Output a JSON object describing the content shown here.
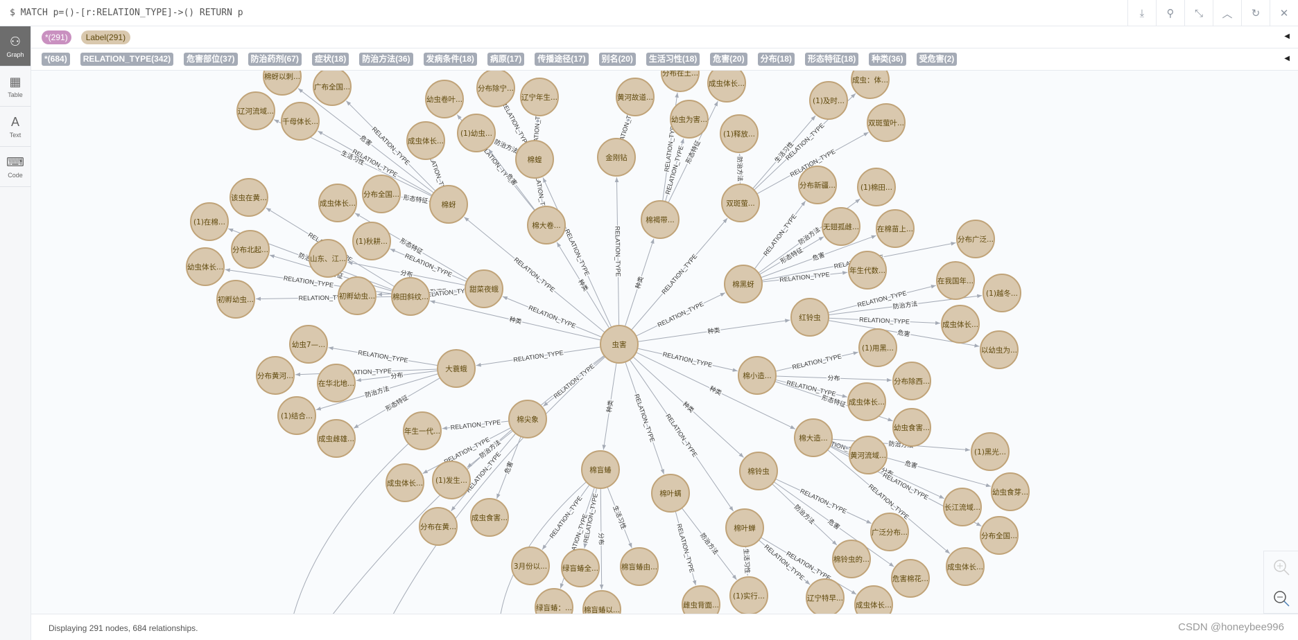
{
  "query": {
    "text": "$ MATCH p=()-[r:RELATION_TYPE]->() RETURN p",
    "buttons": [
      {
        "name": "download-icon",
        "glyph": "⤓"
      },
      {
        "name": "pin-icon",
        "glyph": "⚲"
      },
      {
        "name": "collapse-icon",
        "glyph": "⤡"
      },
      {
        "name": "chevron-up-icon",
        "glyph": "︿"
      },
      {
        "name": "refresh-icon",
        "glyph": "↻"
      },
      {
        "name": "close-icon",
        "glyph": "✕"
      }
    ]
  },
  "sidebar": {
    "tabs": [
      {
        "label": "Graph",
        "icon": "graph-icon",
        "glyph": "⚇"
      },
      {
        "label": "Table",
        "icon": "table-icon",
        "glyph": "▦"
      },
      {
        "label": "Text",
        "icon": "text-icon",
        "glyph": "A"
      },
      {
        "label": "Code",
        "icon": "code-icon",
        "glyph": "⌨"
      }
    ]
  },
  "labels": [
    {
      "text": "*(291)",
      "kind": "star"
    },
    {
      "text": "Label(291)",
      "kind": "label"
    }
  ],
  "relationships": [
    "*(684)",
    "RELATION_TYPE(342)",
    "危害部位(37)",
    "防治药剂(67)",
    "症状(18)",
    "防治方法(36)",
    "发病条件(18)",
    "病原(17)",
    "传播途径(17)",
    "别名(20)",
    "生活习性(18)",
    "危害(20)",
    "分布(18)",
    "形态特征(18)",
    "种类(36)",
    "受危害(2)"
  ],
  "colors": {
    "node_fill": "#d9c8ae",
    "node_stroke": "#c0a378",
    "node_text": "#604a0e",
    "edge": "#a5abb6"
  },
  "graph": {
    "nodes": [
      "虫害",
      "棉蚜",
      "棉蝗",
      "金刚钻",
      "棉褐带...",
      "双斑萤...",
      "棉大卷...",
      "甜菜夜蛾",
      "棉田斜纹...",
      "棉黑蚜",
      "红铃虫",
      "棉小造...",
      "棉大造...",
      "棉铃虫",
      "棉叶蝉",
      "棉叶螨",
      "棉盲蝽",
      "棉尖象",
      "大蓑蛾",
      "棉蚜以刺...",
      "广布全国...",
      "辽河流域...",
      "千母体长...",
      "成虫体长...",
      "分布全国...",
      "幼虫卷叶...",
      "分布除宁...",
      "辽宁年生...",
      "(1)幼虫...",
      "该虫在黄...",
      "成虫体长...",
      "(1)在棉...",
      "(1)秋耕...",
      "分布北起...",
      "山东、江...",
      "幼虫体长...",
      "初孵幼虫...",
      "初孵幼虫...",
      "分布在土...",
      "成虫体长...",
      "黄河故道...",
      "幼虫为害...",
      "(1)释放...",
      "(1)及时...",
      "成虫：体...",
      "双斑萤叶...",
      "分布新疆...",
      "(1)棉田...",
      "无翅孤雌...",
      "在棉苗上...",
      "分布广泛...",
      "年生代数...",
      "在我国年...",
      "(1)越冬...",
      "成虫体长...",
      "(1)用黑...",
      "以幼虫为...",
      "分布除西...",
      "成虫体长...",
      "幼虫食害...",
      "黄河流域...",
      "(1)黑光...",
      "幼虫食芽...",
      "长江流域...",
      "分布全国...",
      "广泛分布...",
      "棉铃虫的...",
      "危害棉花...",
      "成虫体长...",
      "(1)实行...",
      "辽宁特早...",
      "成虫体长...",
      "雌虫背面...",
      "棉盲蝽由...",
      "3月份以...",
      "绿盲蝽全...",
      "绿盲蝽：...",
      "棉盲蝽以...",
      "幼虫7—...",
      "分布黄河...",
      "在华北地...",
      "(1)结合...",
      "成虫雌雄...",
      "年生一代...",
      "成虫体长...",
      "(1)发生...",
      "分布在黄...",
      "成虫食害..."
    ],
    "edges": [
      [
        0,
        1,
        "RELATION_TYPE"
      ],
      [
        0,
        2,
        "RELATION_TYPE"
      ],
      [
        0,
        3,
        "RELATION_TYPE"
      ],
      [
        0,
        4,
        "种类"
      ],
      [
        0,
        5,
        "RELATION_TYPE"
      ],
      [
        0,
        6,
        "种类"
      ],
      [
        0,
        7,
        "RELATION_TYPE"
      ],
      [
        0,
        8,
        "种类"
      ],
      [
        0,
        9,
        "RELATION_TYPE"
      ],
      [
        0,
        10,
        "种类"
      ],
      [
        0,
        11,
        "RELATION_TYPE"
      ],
      [
        0,
        12,
        "种类"
      ],
      [
        0,
        13,
        "种类"
      ],
      [
        0,
        14,
        "RELATION_TYPE"
      ],
      [
        0,
        15,
        "RELATION_TYPE"
      ],
      [
        0,
        16,
        "种类"
      ],
      [
        0,
        17,
        "RELATION_TYPE"
      ],
      [
        0,
        18,
        "RELATION_TYPE"
      ],
      [
        1,
        19,
        "危害"
      ],
      [
        1,
        20,
        "RELATION_TYPE"
      ],
      [
        1,
        21,
        "生活习性"
      ],
      [
        1,
        22,
        "RELATION_TYPE"
      ],
      [
        1,
        23,
        "RELATION_TYPE"
      ],
      [
        1,
        24,
        "形态特征"
      ],
      [
        6,
        25,
        "RELATION_TYPE"
      ],
      [
        2,
        26,
        "RELATION_TYPE"
      ],
      [
        2,
        27,
        "RELATION_TYPE"
      ],
      [
        2,
        28,
        "防治方法"
      ],
      [
        6,
        28,
        "危害"
      ],
      [
        6,
        2,
        "RELATION_TYPE"
      ],
      [
        8,
        29,
        "RELATION_TYPE"
      ],
      [
        7,
        30,
        "形态特征"
      ],
      [
        8,
        31,
        "防治方法"
      ],
      [
        7,
        32,
        "RELATION_TYPE"
      ],
      [
        8,
        33,
        "形态特征"
      ],
      [
        7,
        34,
        "分布"
      ],
      [
        8,
        35,
        "RELATION_TYPE"
      ],
      [
        7,
        36,
        "RELATION_TYPE"
      ],
      [
        8,
        37,
        "RELATION_TYPE"
      ],
      [
        7,
        8,
        "RELATION_TYPE"
      ],
      [
        4,
        38,
        "RELATION_TYPE"
      ],
      [
        4,
        39,
        "形态特征"
      ],
      [
        3,
        40,
        "RELATION_TYPE"
      ],
      [
        4,
        41,
        "RELATION_TYPE"
      ],
      [
        5,
        42,
        "防治方法"
      ],
      [
        5,
        43,
        "生活习性"
      ],
      [
        5,
        44,
        "RELATION_TYPE"
      ],
      [
        5,
        45,
        "RELATION_TYPE"
      ],
      [
        9,
        46,
        "RELATION_TYPE"
      ],
      [
        9,
        47,
        "防治方法"
      ],
      [
        9,
        48,
        "形态特征"
      ],
      [
        9,
        49,
        "危害"
      ],
      [
        9,
        51,
        "RELATION_TYPE"
      ],
      [
        9,
        50,
        "RELATION_TYPE"
      ],
      [
        10,
        52,
        "RELATION_TYPE"
      ],
      [
        10,
        53,
        "防治方法"
      ],
      [
        10,
        54,
        "RELATION_TYPE"
      ],
      [
        10,
        56,
        "危害"
      ],
      [
        11,
        55,
        "RELATION_TYPE"
      ],
      [
        11,
        57,
        "分布"
      ],
      [
        11,
        58,
        "RELATION_TYPE"
      ],
      [
        11,
        59,
        "形态特征"
      ],
      [
        12,
        60,
        "RELATION_TYPE"
      ],
      [
        12,
        61,
        "防治方法"
      ],
      [
        12,
        62,
        "危害"
      ],
      [
        12,
        63,
        "分布"
      ],
      [
        12,
        64,
        "RELATION_TYPE"
      ],
      [
        12,
        68,
        "RELATION_TYPE"
      ],
      [
        13,
        65,
        "RELATION_TYPE"
      ],
      [
        13,
        66,
        "防治方法"
      ],
      [
        13,
        67,
        "危害"
      ],
      [
        14,
        69,
        "生活习性"
      ],
      [
        14,
        70,
        "RELATION_TYPE"
      ],
      [
        14,
        71,
        "RELATION_TYPE"
      ],
      [
        15,
        72,
        "RELATION_TYPE"
      ],
      [
        15,
        69,
        "防治方法"
      ],
      [
        16,
        73,
        "生活习性"
      ],
      [
        16,
        74,
        "RELATION_TYPE"
      ],
      [
        16,
        75,
        "RELATION_TYPE"
      ],
      [
        16,
        76,
        "RELATION_TYPE"
      ],
      [
        16,
        77,
        "分布"
      ],
      [
        18,
        78,
        "RELATION_TYPE"
      ],
      [
        18,
        79,
        "RELATION_TYPE"
      ],
      [
        18,
        80,
        "分布"
      ],
      [
        18,
        81,
        "防治方法"
      ],
      [
        18,
        82,
        "形态特征"
      ],
      [
        17,
        83,
        "RELATION_TYPE"
      ],
      [
        17,
        84,
        "RELATION_TYPE"
      ],
      [
        17,
        85,
        "防治方法"
      ],
      [
        17,
        86,
        "RELATION_TYPE"
      ],
      [
        17,
        87,
        "危害"
      ]
    ]
  },
  "footer": {
    "status": "Displaying 291 nodes, 684 relationships.",
    "watermark": "CSDN @honeybee996"
  },
  "zoom": {
    "in": "zoom-in-icon",
    "out": "zoom-out-icon"
  }
}
